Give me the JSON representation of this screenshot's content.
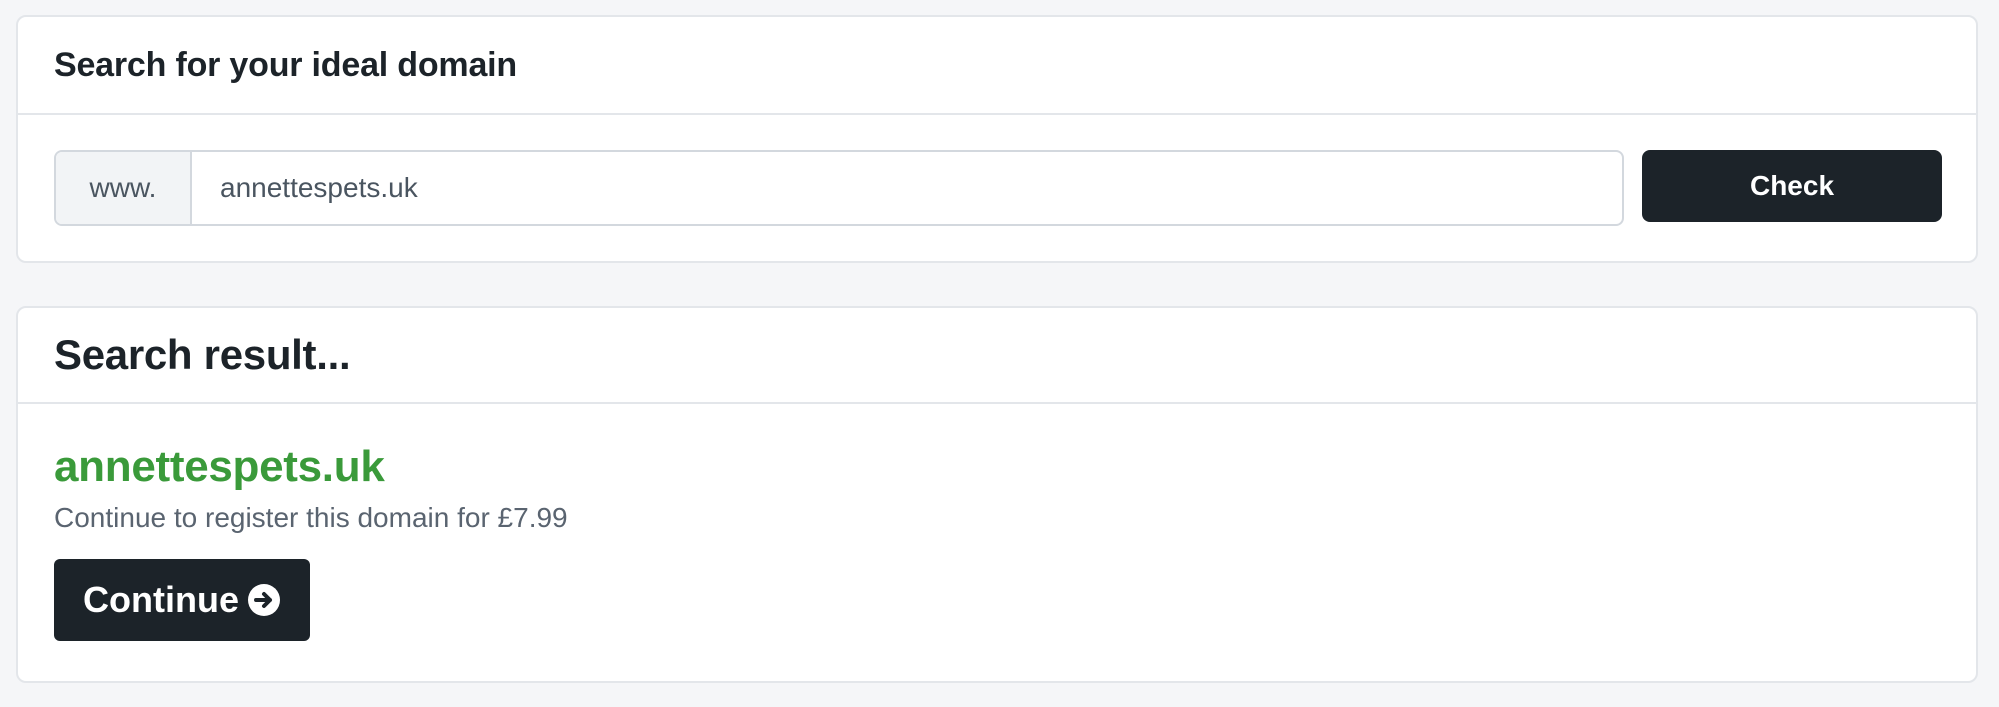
{
  "search_card": {
    "title": "Search for your ideal domain",
    "prefix": "www.",
    "input_value": "annettespets.uk",
    "check_label": "Check"
  },
  "result_card": {
    "title": "Search result...",
    "domain": "annettespets.uk",
    "price_text": "Continue to register this domain for £7.99",
    "continue_label": "Continue",
    "continue_icon": "arrow-circle-right-icon"
  },
  "colors": {
    "dark": "#1c2329",
    "available_green": "#3a9a3a",
    "page_background": "#f5f6f8"
  }
}
